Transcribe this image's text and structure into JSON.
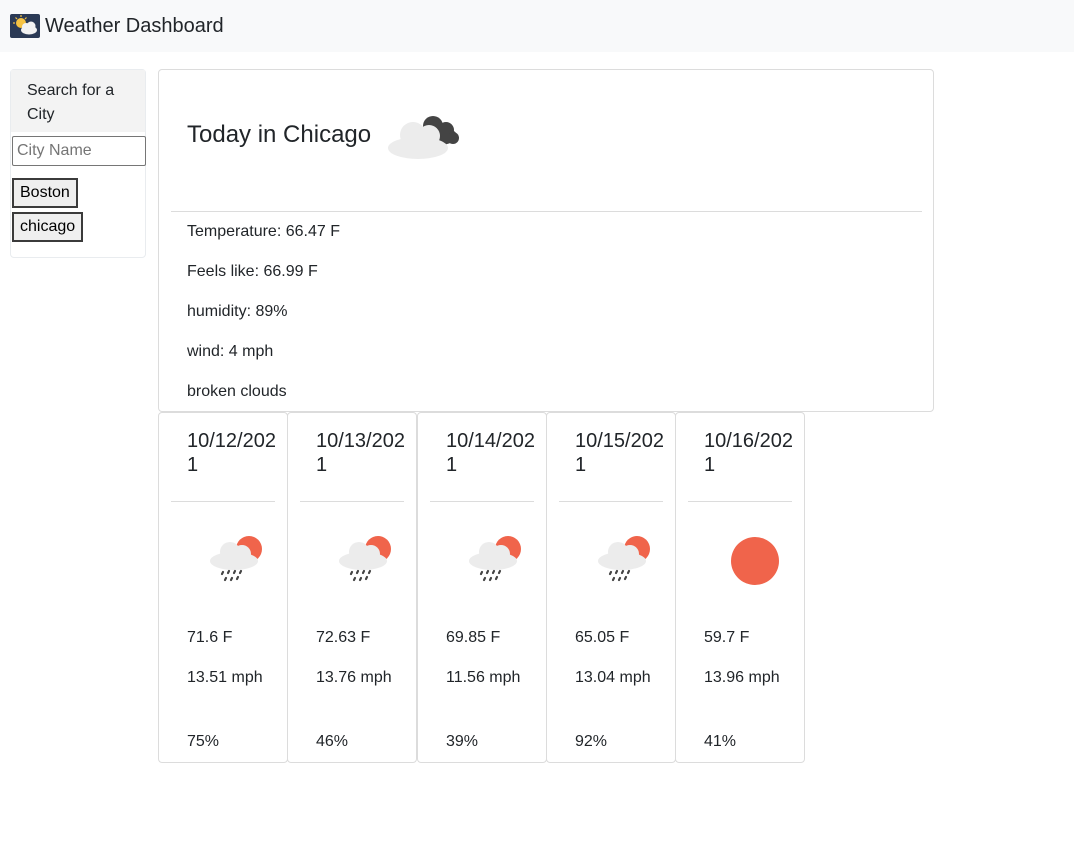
{
  "navbar": {
    "title": "Weather Dashboard",
    "icon": "sun-behind-cloud-icon"
  },
  "sidebar": {
    "header": "Search for a City",
    "search": {
      "placeholder": "City Name",
      "value": ""
    },
    "history": [
      "Boston",
      "chicago"
    ]
  },
  "today": {
    "title": "Today in Chicago",
    "icon": "broken-clouds-icon",
    "temperature": "Temperature: 66.47 F",
    "feels_like": "Feels like: 66.99 F",
    "humidity": "humidity: 89%",
    "wind": "wind: 4 mph",
    "description": "broken clouds"
  },
  "forecast": [
    {
      "date": "10/12/2021",
      "icon": "rain-sun-cloud-icon",
      "temp": "71.6 F",
      "wind": "13.51 mph",
      "humidity": "75%"
    },
    {
      "date": "10/13/2021",
      "icon": "rain-sun-cloud-icon",
      "temp": "72.63 F",
      "wind": "13.76 mph",
      "humidity": "46%"
    },
    {
      "date": "10/14/2021",
      "icon": "rain-sun-cloud-icon",
      "temp": "69.85 F",
      "wind": "11.56 mph",
      "humidity": "39%"
    },
    {
      "date": "10/15/2021",
      "icon": "rain-sun-cloud-icon",
      "temp": "65.05 F",
      "wind": "13.04 mph",
      "humidity": "92%"
    },
    {
      "date": "10/16/2021",
      "icon": "sun-icon",
      "temp": "59.7 F",
      "wind": "13.96 mph",
      "humidity": "41%"
    }
  ],
  "colors": {
    "navbar_bg": "#f8f9fa",
    "sun": "#f0644b",
    "cloud_light": "#ececec",
    "cloud_dark": "#444444"
  }
}
